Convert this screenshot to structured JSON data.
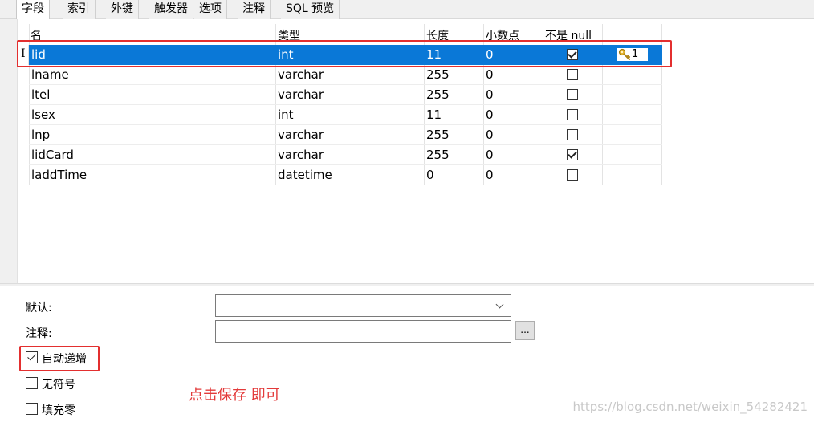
{
  "tabs": [
    {
      "label": "字段",
      "active": true
    },
    {
      "label": "索引"
    },
    {
      "label": "外键"
    },
    {
      "label": "触发器"
    },
    {
      "label": "选项"
    },
    {
      "label": "注释"
    },
    {
      "label": "SQL 预览"
    }
  ],
  "grid": {
    "headers": {
      "name": "名",
      "type": "类型",
      "length": "长度",
      "decimals": "小数点",
      "not_null": "不是 null"
    },
    "cursor_glyph": "I",
    "rows": [
      {
        "name": "lid",
        "type": "int",
        "length": "11",
        "decimals": "0",
        "not_null": true,
        "key": "1",
        "selected": true
      },
      {
        "name": "lname",
        "type": "varchar",
        "length": "255",
        "decimals": "0",
        "not_null": false
      },
      {
        "name": "ltel",
        "type": "varchar",
        "length": "255",
        "decimals": "0",
        "not_null": false
      },
      {
        "name": "lsex",
        "type": "int",
        "length": "11",
        "decimals": "0",
        "not_null": false
      },
      {
        "name": "lnp",
        "type": "varchar",
        "length": "255",
        "decimals": "0",
        "not_null": false
      },
      {
        "name": "lidCard",
        "type": "varchar",
        "length": "255",
        "decimals": "0",
        "not_null": true
      },
      {
        "name": "laddTime",
        "type": "datetime",
        "length": "0",
        "decimals": "0",
        "not_null": false
      }
    ]
  },
  "props": {
    "default_label": "默认:",
    "default_value": "",
    "comment_label": "注释:",
    "comment_value": "",
    "ellipsis": "...",
    "auto_increment": {
      "label": "自动递增",
      "checked": true
    },
    "unsigned": {
      "label": "无符号",
      "checked": false
    },
    "zerofill": {
      "label": "填充零",
      "checked": false
    }
  },
  "annotation": "点击保存 即可",
  "watermark": "https://blog.csdn.net/weixin_54282421",
  "colors": {
    "selection": "#0a78d7",
    "annotation_red": "#e32f2f"
  }
}
